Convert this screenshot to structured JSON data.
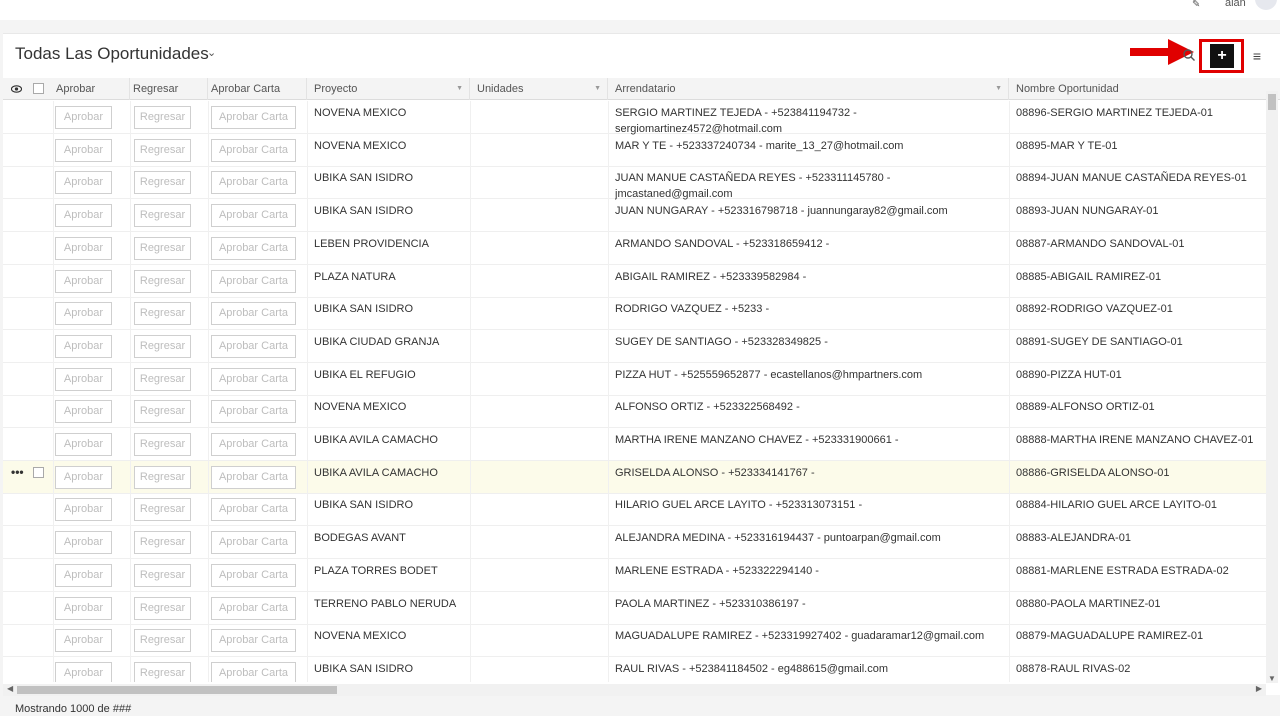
{
  "topbar": {
    "user": "alan"
  },
  "header": {
    "title": "Todas Las Oportunidades"
  },
  "columns": {
    "aprobar": "Aprobar",
    "regresar": "Regresar",
    "aprobar_carta": "Aprobar Carta",
    "proyecto": "Proyecto",
    "unidades": "Unidades",
    "arrendatario": "Arrendatario",
    "nombre": "Nombre Oportunidad"
  },
  "buttons": {
    "aprobar": "Aprobar",
    "regresar": "Regresar",
    "aprobar_carta": "Aprobar Carta"
  },
  "rows": [
    {
      "proyecto": "NOVENA MEXICO",
      "arrendatario": "SERGIO MARTINEZ TEJEDA - +523841194732 -",
      "arrendatario2": "sergiomartinez4572@hotmail.com",
      "nombre": "08896-SERGIO MARTINEZ TEJEDA-01"
    },
    {
      "proyecto": "NOVENA MEXICO",
      "arrendatario": "MAR Y TE - +523337240734 - marite_13_27@hotmail.com",
      "nombre": "08895-MAR Y TE-01"
    },
    {
      "proyecto": "UBIKA SAN ISIDRO",
      "arrendatario": "JUAN MANUE CASTAÑEDA REYES - +523311145780 - jmcastaned@gmail.com",
      "nombre": "08894-JUAN MANUE CASTAÑEDA REYES-01"
    },
    {
      "proyecto": "UBIKA SAN ISIDRO",
      "arrendatario": "JUAN NUNGARAY - +523316798718 - juannungaray82@gmail.com",
      "nombre": "08893-JUAN NUNGARAY-01"
    },
    {
      "proyecto": "LEBEN PROVIDENCIA",
      "arrendatario": "ARMANDO SANDOVAL - +523318659412 -",
      "nombre": "08887-ARMANDO SANDOVAL-01"
    },
    {
      "proyecto": "PLAZA NATURA",
      "arrendatario": "ABIGAIL RAMIREZ - +523339582984 -",
      "nombre": "08885-ABIGAIL RAMIREZ-01"
    },
    {
      "proyecto": "UBIKA SAN ISIDRO",
      "arrendatario": "RODRIGO VAZQUEZ - +5233 -",
      "nombre": "08892-RODRIGO VAZQUEZ-01"
    },
    {
      "proyecto": "UBIKA CIUDAD GRANJA",
      "arrendatario": "SUGEY DE SANTIAGO - +523328349825 -",
      "nombre": "08891-SUGEY DE SANTIAGO-01"
    },
    {
      "proyecto": "UBIKA EL REFUGIO",
      "arrendatario": "PIZZA HUT - +525559652877 - ecastellanos@hmpartners.com",
      "nombre": "08890-PIZZA HUT-01"
    },
    {
      "proyecto": "NOVENA MEXICO",
      "arrendatario": "ALFONSO ORTIZ - +523322568492 -",
      "nombre": "08889-ALFONSO ORTIZ-01"
    },
    {
      "proyecto": "UBIKA AVILA CAMACHO",
      "arrendatario": "MARTHA IRENE MANZANO CHAVEZ - +523331900661 -",
      "nombre": "08888-MARTHA IRENE MANZANO CHAVEZ-01"
    },
    {
      "proyecto": "UBIKA AVILA CAMACHO",
      "arrendatario": "GRISELDA ALONSO - +523334141767 -",
      "nombre": "08886-GRISELDA ALONSO-01",
      "selected": true
    },
    {
      "proyecto": "UBIKA SAN ISIDRO",
      "arrendatario": "HILARIO GUEL ARCE LAYITO - +523313073151 -",
      "nombre": "08884-HILARIO GUEL ARCE LAYITO-01"
    },
    {
      "proyecto": "BODEGAS AVANT",
      "arrendatario": "ALEJANDRA MEDINA - +523316194437 - puntoarpan@gmail.com",
      "nombre": "08883-ALEJANDRA-01"
    },
    {
      "proyecto": "PLAZA TORRES BODET",
      "arrendatario": "MARLENE ESTRADA - +523322294140 -",
      "nombre": "08881-MARLENE ESTRADA ESTRADA-02"
    },
    {
      "proyecto": "TERRENO PABLO NERUDA",
      "arrendatario": "PAOLA MARTINEZ - +523310386197 -",
      "nombre": "08880-PAOLA MARTINEZ-01"
    },
    {
      "proyecto": "NOVENA MEXICO",
      "arrendatario": "MAGUADALUPE RAMIREZ - +523319927402 - guadaramar12@gmail.com",
      "nombre": "08879-MAGUADALUPE RAMIREZ-01"
    },
    {
      "proyecto": "UBIKA SAN ISIDRO",
      "arrendatario": "RAUL RIVAS - +523841184502 - eg488615@gmail.com",
      "nombre": "08878-RAUL RIVAS-02"
    }
  ],
  "footer": {
    "text": "Mostrando 1000 de ###"
  }
}
